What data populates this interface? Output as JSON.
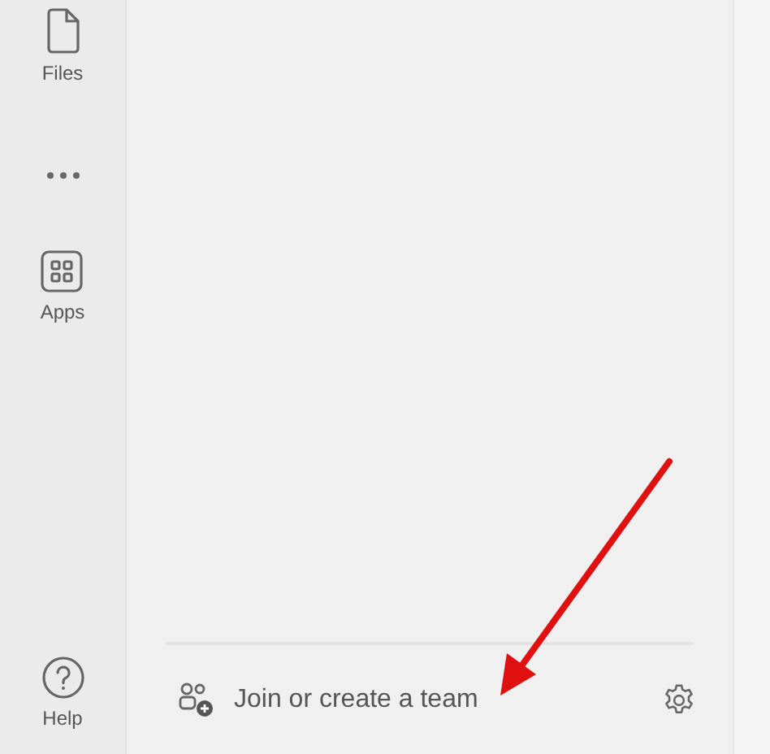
{
  "rail": {
    "items": [
      {
        "kind": "files",
        "label": "Files"
      },
      {
        "kind": "more"
      },
      {
        "kind": "apps",
        "label": "Apps"
      }
    ],
    "help": {
      "label": "Help"
    }
  },
  "footer": {
    "join_label": "Join or create a team"
  },
  "annotation": {
    "kind": "arrow",
    "color": "#e01010"
  }
}
